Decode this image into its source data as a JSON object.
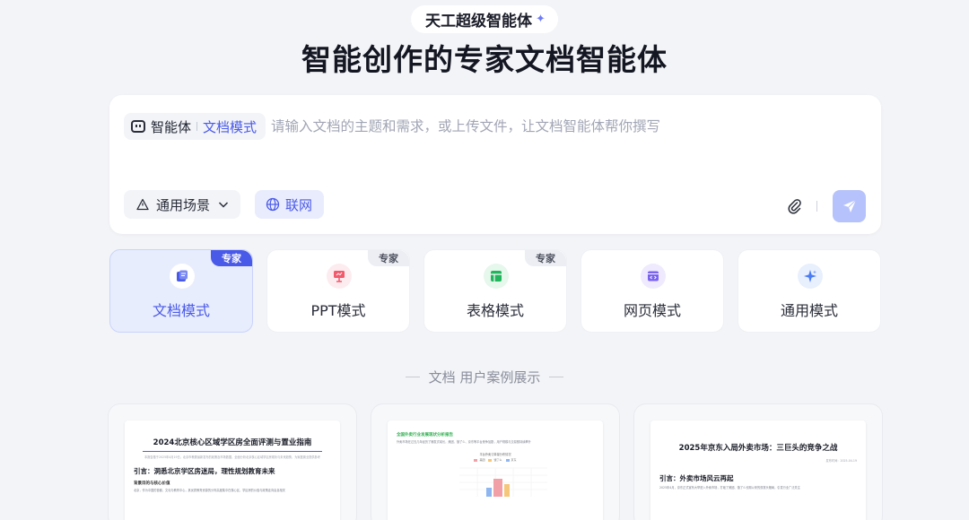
{
  "brand": {
    "name": "天工超级智能体"
  },
  "hero": {
    "title": "智能创作的专家文档智能体"
  },
  "composer": {
    "agent_label": "智能体",
    "mode_label": "文档模式",
    "placeholder": "请输入文档的主题和需求，或上传文件，让文档智能体帮你撰写",
    "scene_label": "通用场景",
    "web_label": "联网"
  },
  "modes": [
    {
      "label": "文档模式",
      "badge": "专家",
      "active": true,
      "icon": "document-icon",
      "color": "#4a5ae8"
    },
    {
      "label": "PPT模式",
      "badge": "专家",
      "icon": "presentation-icon",
      "color": "#f25a6d"
    },
    {
      "label": "表格模式",
      "badge": "专家",
      "icon": "table-icon",
      "color": "#22b55e"
    },
    {
      "label": "网页模式",
      "badge": "",
      "icon": "code-window-icon",
      "color": "#7b63f0"
    },
    {
      "label": "通用模式",
      "badge": "",
      "icon": "sparkle-icon",
      "color": "#4a7cf5"
    }
  ],
  "cases": {
    "heading": "文档 用户案例展示",
    "items": [
      {
        "title": "2024北京核心区域学区房全面评测与置业指南",
        "caption": "本报告基于2025年4月19日，北京市教委最新发布的政策及市场数据，全面分析北京核心区域学区房现状与未来趋势，为家庭置业提供参考",
        "h2": "引言：洞悉北京学区房迷局，理性规划教育未来",
        "h3": "背景目的与核心价值",
        "body": "北京，作为中国的首都，文化与教育中心，其优质教育资源的分布高度集中在核心区，学区房的价值与政策走向息息相关"
      },
      {
        "heading": "全国外卖行业发展现状分析报告",
        "body": "外卖市场在过去几年经历了爆发式增长，美团、饿了么、京东等平台竞争加剧，用户规模与交易额持续攀升",
        "chart_title": "平台外卖订单量分布情况",
        "legend": [
          "美团",
          "饿了么",
          "京东"
        ]
      },
      {
        "title": "2025年京东入局外卖市场：三巨头的竞争之战",
        "caption": "发布时间：2025-04-19",
        "h2": "引言：外卖市场风云再起",
        "body": "2025年4月，京东正式宣布大举进入外卖市场，打破了美团、饿了么长期以来的双寡头格局，引发行业广泛关注"
      }
    ]
  }
}
